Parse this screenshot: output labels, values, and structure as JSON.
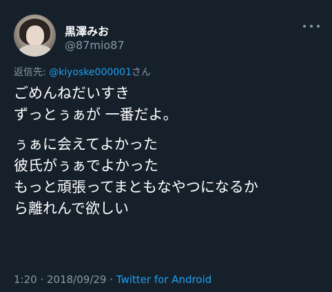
{
  "user": {
    "display_name": "黒澤みお",
    "handle": "@87mio87",
    "avatar_icon": "user-avatar"
  },
  "reply": {
    "prefix": "返信先:",
    "mention": "@kiyoske000001",
    "suffix": "さん"
  },
  "tweet": {
    "paragraph1": [
      "ごめんねだいすき",
      "ずっとぅぁが 一番だよ。"
    ],
    "paragraph2": [
      "ぅぁに会えてよかった",
      "彼氏がぅぁでよかった",
      "もっと頑張ってまともなやつになるか",
      "ら離れんで欲しい"
    ]
  },
  "meta": {
    "time": "1:20",
    "separator": " · ",
    "date": "2018/09/29",
    "source": "Twitter for Android"
  },
  "colors": {
    "background": "#15202b",
    "secondary_text": "#8899a6",
    "link": "#1da1f2"
  }
}
